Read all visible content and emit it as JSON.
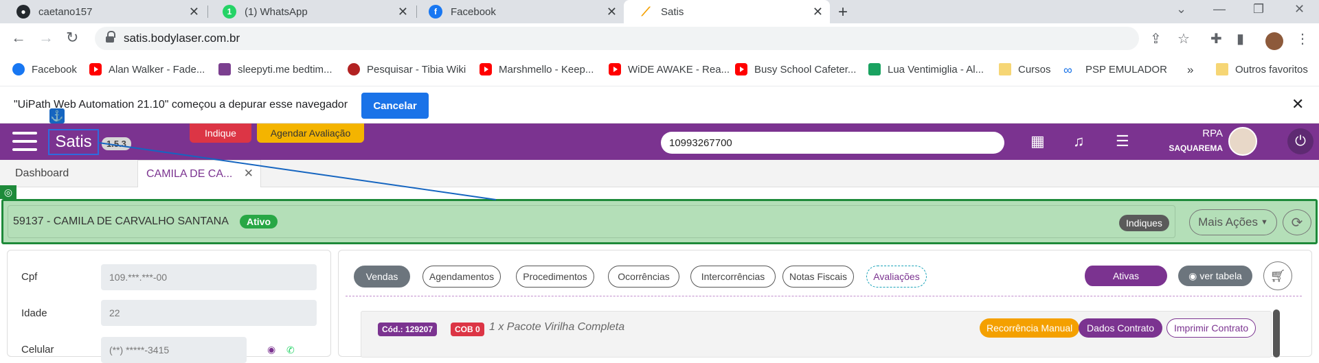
{
  "browser": {
    "tabs": [
      {
        "title": "caetano157",
        "icon": "github-icon"
      },
      {
        "title": "(1) WhatsApp",
        "icon": "whatsapp-icon",
        "badge": "1"
      },
      {
        "title": "Facebook",
        "icon": "facebook-icon"
      },
      {
        "title": "Satis",
        "icon": "satis-icon"
      }
    ],
    "url": "satis.bodylaser.com.br",
    "bookmarks": [
      {
        "label": "Facebook",
        "icon": "facebook-icon"
      },
      {
        "label": "Alan Walker - Fade...",
        "icon": "youtube-icon"
      },
      {
        "label": "sleepyti.me bedtim...",
        "icon": "sleepytime-icon"
      },
      {
        "label": "Pesquisar - Tibia Wiki",
        "icon": "tibia-icon"
      },
      {
        "label": "Marshmello - Keep...",
        "icon": "youtube-icon"
      },
      {
        "label": "WiDE AWAKE - Rea...",
        "icon": "youtube-icon"
      },
      {
        "label": "Busy School Cafeter...",
        "icon": "youtube-icon"
      },
      {
        "label": "Lua Ventimiglia - Al...",
        "icon": "image-icon"
      },
      {
        "label": "Cursos",
        "icon": "folder-icon"
      },
      {
        "label": "PSP EMULADOR",
        "icon": "infinity-icon"
      }
    ],
    "bookmarks_more": "»",
    "other_bookmarks": "Outros favoritos"
  },
  "infobar": {
    "text": "\"UiPath Web Automation 21.10\" começou a depurar esse navegador",
    "cancel": "Cancelar"
  },
  "app": {
    "brand": "Satis",
    "version": "1.5.3",
    "indique": "Indique",
    "agendar": "Agendar Avaliação",
    "search_value": "10993267700",
    "user_name": "RPA",
    "user_unit": "SAQUAREMA",
    "colors": {
      "primary": "#7b3390",
      "danger": "#dc3545",
      "warning": "#f4b400",
      "success": "#28a745"
    }
  },
  "apptabs": {
    "dashboard": "Dashboard",
    "patient_tab": "CAMILA DE CA..."
  },
  "patient": {
    "title": "59137 - CAMILA DE CARVALHO SANTANA",
    "status": "Ativo",
    "indiques": "Indiques",
    "mais_acoes": "Mais Ações"
  },
  "fields": [
    {
      "label": "Cpf",
      "value": "109.***.***-00"
    },
    {
      "label": "Idade",
      "value": "22"
    },
    {
      "label": "Celular",
      "value": "(**) *****-3415"
    }
  ],
  "section_tabs": [
    "Vendas",
    "Agendamentos",
    "Procedimentos",
    "Ocorrências",
    "Intercorrências",
    "Notas Fiscais",
    "Avaliações"
  ],
  "filters": {
    "ativas": "Ativas",
    "ver_tabela": "ver tabela"
  },
  "sale": {
    "code": "Cód.: 129207",
    "cob": "COB 0",
    "description": "1 x Pacote Virilha Completa",
    "recorrencia": "Recorrência Manual",
    "dados": "Dados Contrato",
    "imprimir": "Imprimir Contrato"
  }
}
